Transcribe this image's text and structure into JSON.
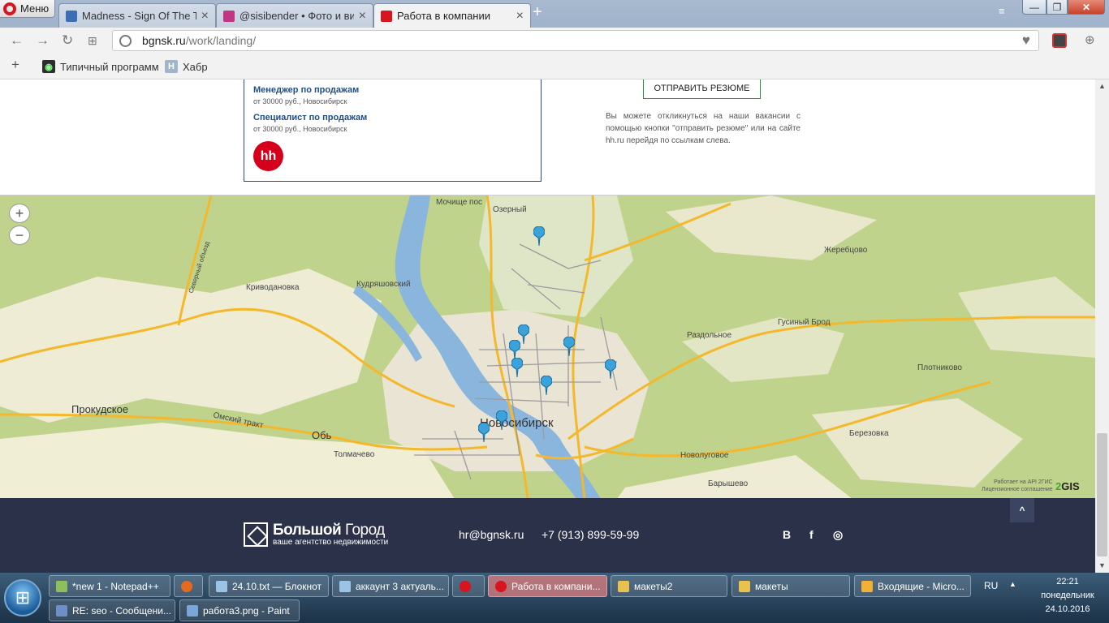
{
  "browser": {
    "menu_label": "Меню",
    "tabs": [
      {
        "label": "Madness - Sign Of The Tim",
        "icon_color": "#3c6fb3"
      },
      {
        "label": "@sisibender • Фото и вид",
        "icon_color": "#c13584"
      },
      {
        "label": "Работа в компании",
        "icon_color": "#d8141e"
      }
    ],
    "url_host": "bgnsk.ru",
    "url_path": "/work/landing/",
    "bookmarks": [
      {
        "label": "Типичный программ",
        "icon": "alien-avatar-icon"
      },
      {
        "label": "Хабр",
        "icon": "H"
      }
    ]
  },
  "page": {
    "vacancies": [
      {
        "title": "Менеджер по продажам",
        "meta": "от 30000 руб., Новосибирск"
      },
      {
        "title": "Специалист по продажам",
        "meta": "от 30000 руб., Новосибирск"
      }
    ],
    "hh_logo": "hh",
    "resume_button": "ОТПРАВИТЬ РЕЗЮМЕ",
    "hint": "Вы можете откликнуться на наши вакансии с помощью кнопки \"отправить резюме\" или на сайте hh.ru перейдя по ссылкам слева."
  },
  "map": {
    "zoom_in": "+",
    "zoom_out": "−",
    "labels": {
      "mochishche": "Мочище пос",
      "ozerny": "Озерный",
      "kudryashovsky": "Кудряшовский",
      "krivodanovka": "Криводановка",
      "zherebtsovo": "Жеребцово",
      "razdolnoe": "Раздольное",
      "gusiny_brod": "Гусиный Брод",
      "plotnikovo": "Плотниково",
      "prokudskoe": "Прокудское",
      "omsky_trakt": "Омский тракт",
      "ob": "Обь",
      "novosibirsk": "Новосибирск",
      "tolmachevo": "Толмачево",
      "berezovka": "Березовка",
      "novolugovoe": "Новолуговое",
      "baryshevo": "Барышево",
      "severny_obezd": "Северный объезд"
    },
    "attribution": "Работает на API 2ГИС",
    "license": "Лицензионное соглашение",
    "gis_logo_num": "2",
    "gis_logo_text": "GIS"
  },
  "footer": {
    "brand_bold": "Большой",
    "brand_light": "Город",
    "brand_sub": "ваше агентство недвижимости",
    "email": "hr@bgnsk.ru",
    "phone": "+7 (913) 899-59-99",
    "social": [
      "B",
      "f",
      "◎"
    ],
    "to_top": "^"
  },
  "taskbar": {
    "tasks": [
      {
        "label": "*new 1 - Notepad++",
        "icon_color": "#8fbf5a"
      },
      {
        "label": "24.10.txt — Блокнот",
        "icon_color": "#9cc3e6"
      },
      {
        "label": "аккаунт 3 актуаль...",
        "icon_color": "#9cc3e6"
      },
      {
        "label": "Работа в компани...",
        "icon_color": "#d8141e"
      },
      {
        "label": "макеты2",
        "icon_color": "#e8c24d"
      },
      {
        "label": "макеты",
        "icon_color": "#e8c24d"
      },
      {
        "label": "Входящие - Micro...",
        "icon_color": "#f2b134"
      },
      {
        "label": "RE: seo - Сообщени...",
        "icon_color": "#6d8fc7"
      },
      {
        "label": "работа3.png - Paint",
        "icon_color": "#7aa7d8"
      }
    ],
    "lang": "RU",
    "time": "22:21",
    "weekday": "понедельник",
    "date": "24.10.2016"
  }
}
